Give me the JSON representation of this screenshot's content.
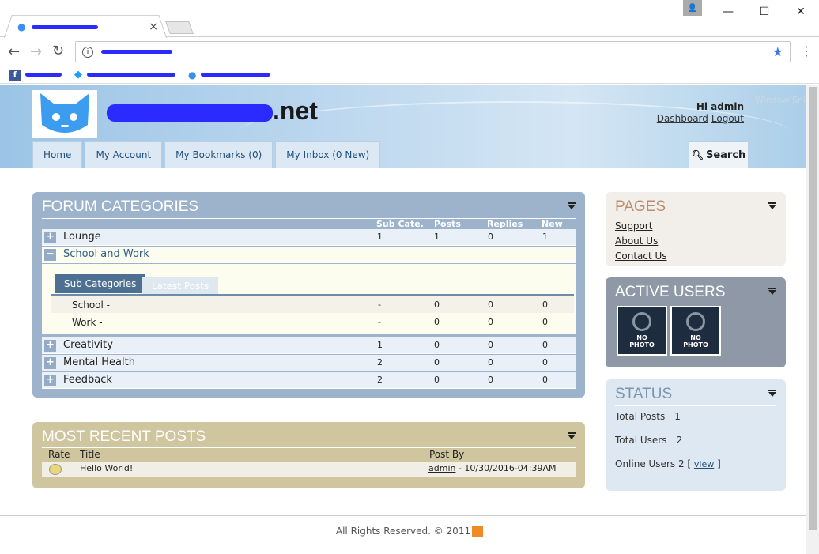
{
  "browser": {
    "window_buttons": {
      "user": "👤",
      "minimize": "—",
      "maximize": "☐",
      "close": "✕"
    },
    "tab_close": "×",
    "back": "←",
    "forward": "→",
    "reload": "↻",
    "menu": "⋮",
    "star": "★"
  },
  "site": {
    "name_suffix": ".net",
    "greeting": "Hi admin",
    "dashboard": "Dashboard",
    "logout": "Logout",
    "window_snip": "Window Sni"
  },
  "nav": {
    "tabs": [
      "Home",
      "My Account",
      "My Bookmarks (0)",
      "My Inbox (0 New)"
    ],
    "search": "Search"
  },
  "forum": {
    "title": "FORUM CATEGORIES",
    "columns": [
      "Sub Cate.",
      "Posts",
      "Replies",
      "New"
    ],
    "lounge": {
      "name": "Lounge",
      "sub": "1",
      "posts": "1",
      "replies": "0",
      "new": "1"
    },
    "school": {
      "name": "School and Work"
    },
    "subtabs": [
      "Sub Categories",
      "Latest Posts"
    ],
    "subs": [
      {
        "name": "School -",
        "sub": "-",
        "posts": "0",
        "replies": "0",
        "new": "0"
      },
      {
        "name": "Work -",
        "sub": "-",
        "posts": "0",
        "replies": "0",
        "new": "0"
      }
    ],
    "rows": [
      {
        "name": "Creativity",
        "sub": "1",
        "posts": "0",
        "replies": "0",
        "new": "0"
      },
      {
        "name": "Mental Health",
        "sub": "2",
        "posts": "0",
        "replies": "0",
        "new": "0"
      },
      {
        "name": "Feedback",
        "sub": "2",
        "posts": "0",
        "replies": "0",
        "new": "0"
      }
    ]
  },
  "recent": {
    "title": "MOST RECENT POSTS",
    "columns": [
      "Rate",
      "Title",
      "Post By"
    ],
    "post": {
      "title": "Hello World!",
      "author": "admin",
      "date": " - 10/30/2016-04:39AM"
    }
  },
  "pages": {
    "title": "PAGES",
    "links": [
      "Support",
      "About Us",
      "Contact Us"
    ]
  },
  "active": {
    "title": "ACTIVE USERS",
    "photo": [
      "NO",
      "PHOTO"
    ]
  },
  "status": {
    "title": "STATUS",
    "posts_label": "Total Posts",
    "posts": "1",
    "users_label": "Total Users",
    "users": "2",
    "online_label": "Online Users 2",
    "view": "view",
    "open": "[",
    "close": "]"
  },
  "footer": {
    "text": "All Rights Reserved. © 2011"
  }
}
